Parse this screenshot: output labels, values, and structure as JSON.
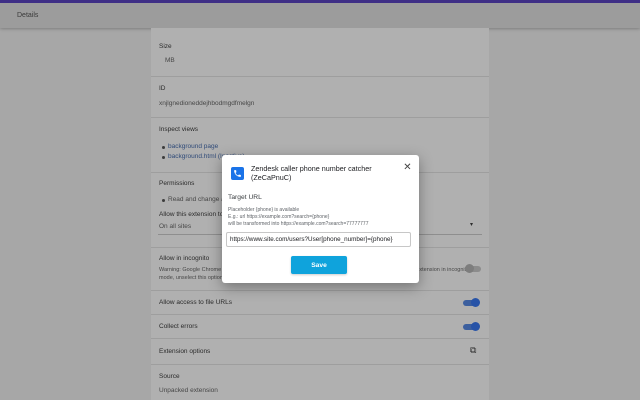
{
  "header": {
    "title": "Details"
  },
  "background": {
    "size_label": "Size",
    "size_value": "MB",
    "id_label": "ID",
    "id_value": "xnjlgnedioneddejhbodmgdfmelgn",
    "inspect_label": "Inspect views",
    "inspect_items": [
      "background page",
      "background.html (Inactive)"
    ],
    "permissions_label": "Permissions",
    "permissions_items": [
      "Read and change all your data on websites"
    ],
    "site_access_label": "Allow this extension to read and change all your data on websites you visit:",
    "site_access_value": "On all sites",
    "incognito_label": "Allow in incognito",
    "incognito_desc": "Warning: Google Chrome cannot prevent extensions from recording your browsing history. To disable this extension in incognito mode, unselect this option.",
    "file_urls_label": "Allow access to file URLs",
    "collect_errors_label": "Collect errors",
    "options_label": "Extension options",
    "source_label": "Source",
    "source_value": "Unpacked extension"
  },
  "dialog": {
    "title": "Zendesk caller phone number catcher (ZeCaPnuC)",
    "field_label": "Target URL",
    "help_lines": [
      "Placeholder {phone} is available",
      "E.g.: url https://example.com?search={phone}",
      "will be transformed into https://example.com?search=77777777"
    ],
    "url_value": "https://www.site.com/users?User[phone_number]={phone}",
    "save_label": "Save"
  },
  "colors": {
    "accent": "#0fa3dc",
    "icon_bg": "#1a73e8",
    "toggle_on": "#2753a7",
    "topbar_border": "#3f2f86"
  },
  "icons": {
    "app": "phone-icon",
    "close": "close-icon"
  }
}
